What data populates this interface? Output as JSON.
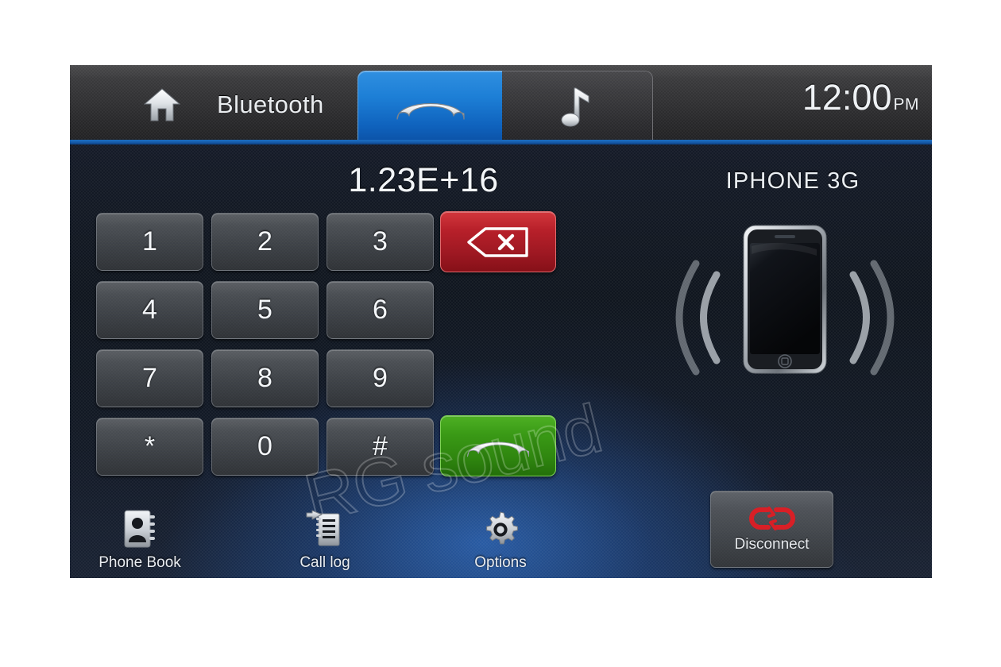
{
  "header": {
    "home_icon": "home-icon",
    "title": "Bluetooth",
    "tabs": [
      {
        "id": "phone",
        "icon": "phone-handset-icon",
        "active": true
      },
      {
        "id": "music",
        "icon": "music-note-icon",
        "active": false
      }
    ],
    "clock": {
      "time": "12:00",
      "meridiem": "PM"
    }
  },
  "main": {
    "dialed_number": "1.23E+16",
    "device_name": "IPHONE 3G",
    "keypad": [
      {
        "key": "1"
      },
      {
        "key": "2"
      },
      {
        "key": "3"
      },
      {
        "key": "4"
      },
      {
        "key": "5"
      },
      {
        "key": "6"
      },
      {
        "key": "7"
      },
      {
        "key": "8"
      },
      {
        "key": "9"
      },
      {
        "key": "*"
      },
      {
        "key": "0"
      },
      {
        "key": "#"
      }
    ],
    "backspace": {
      "icon": "backspace-delete-icon",
      "color": "#b8202a"
    },
    "call": {
      "icon": "call-handset-icon",
      "color": "#3a9a16"
    },
    "disconnect": {
      "label": "Disconnect",
      "icon": "broken-chain-link-icon",
      "icon_color": "#d81f26"
    },
    "phone_image": {
      "icon": "iphone-device-illustration",
      "waves": "bluetooth-sound-waves"
    }
  },
  "toolbar": {
    "items": [
      {
        "label": "Phone Book",
        "icon": "address-book-icon"
      },
      {
        "label": "Call log",
        "icon": "call-log-list-icon"
      },
      {
        "label": "Options",
        "icon": "gear-icon"
      }
    ]
  },
  "watermark": {
    "text": "RG sound"
  },
  "colors": {
    "accent_blue": "#1d7fd6",
    "tab_underline": "#1559a8",
    "red": "#b8202a",
    "green": "#3a9a16"
  }
}
